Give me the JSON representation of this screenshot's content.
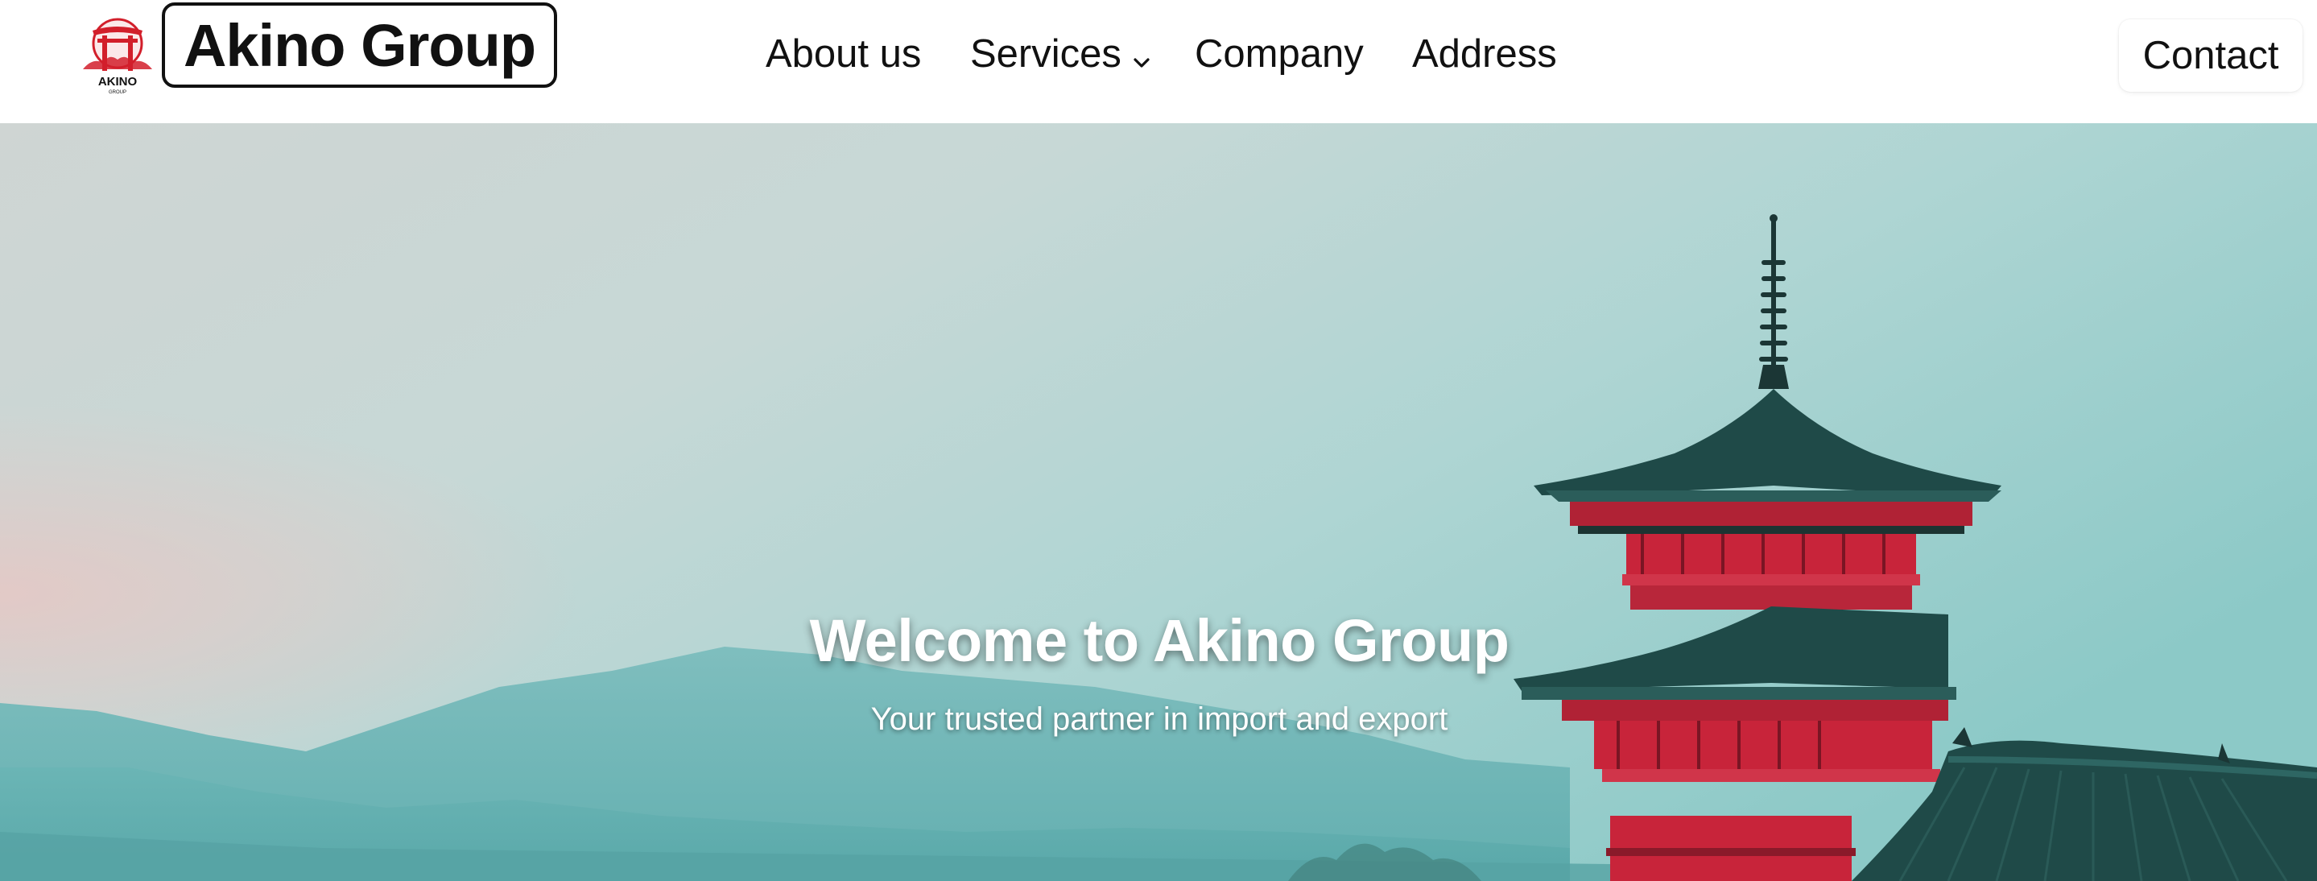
{
  "brand": {
    "name": "Akino Group",
    "emblem_text": "AKINO",
    "emblem_subtext": "GROUP",
    "emblem_icon": "torii-gate-icon",
    "accent_color": "#d21f2b"
  },
  "nav": {
    "items": [
      {
        "label": "About us"
      },
      {
        "label": "Services",
        "has_dropdown": true,
        "icon": "chevron-down-icon"
      },
      {
        "label": "Company"
      },
      {
        "label": "Address"
      }
    ],
    "contact_label": "Contact"
  },
  "hero": {
    "title": "Welcome to Akino Group",
    "subtitle": "Your trusted partner in import and export",
    "image_subject": "pagoda-with-mountains",
    "colors": {
      "sky_top": "#93cdcb",
      "sky_mid": "#cfd7d6",
      "mountain": "#6bb6b6",
      "pagoda_roof": "#1f4a48",
      "pagoda_red": "#c8243a"
    }
  }
}
